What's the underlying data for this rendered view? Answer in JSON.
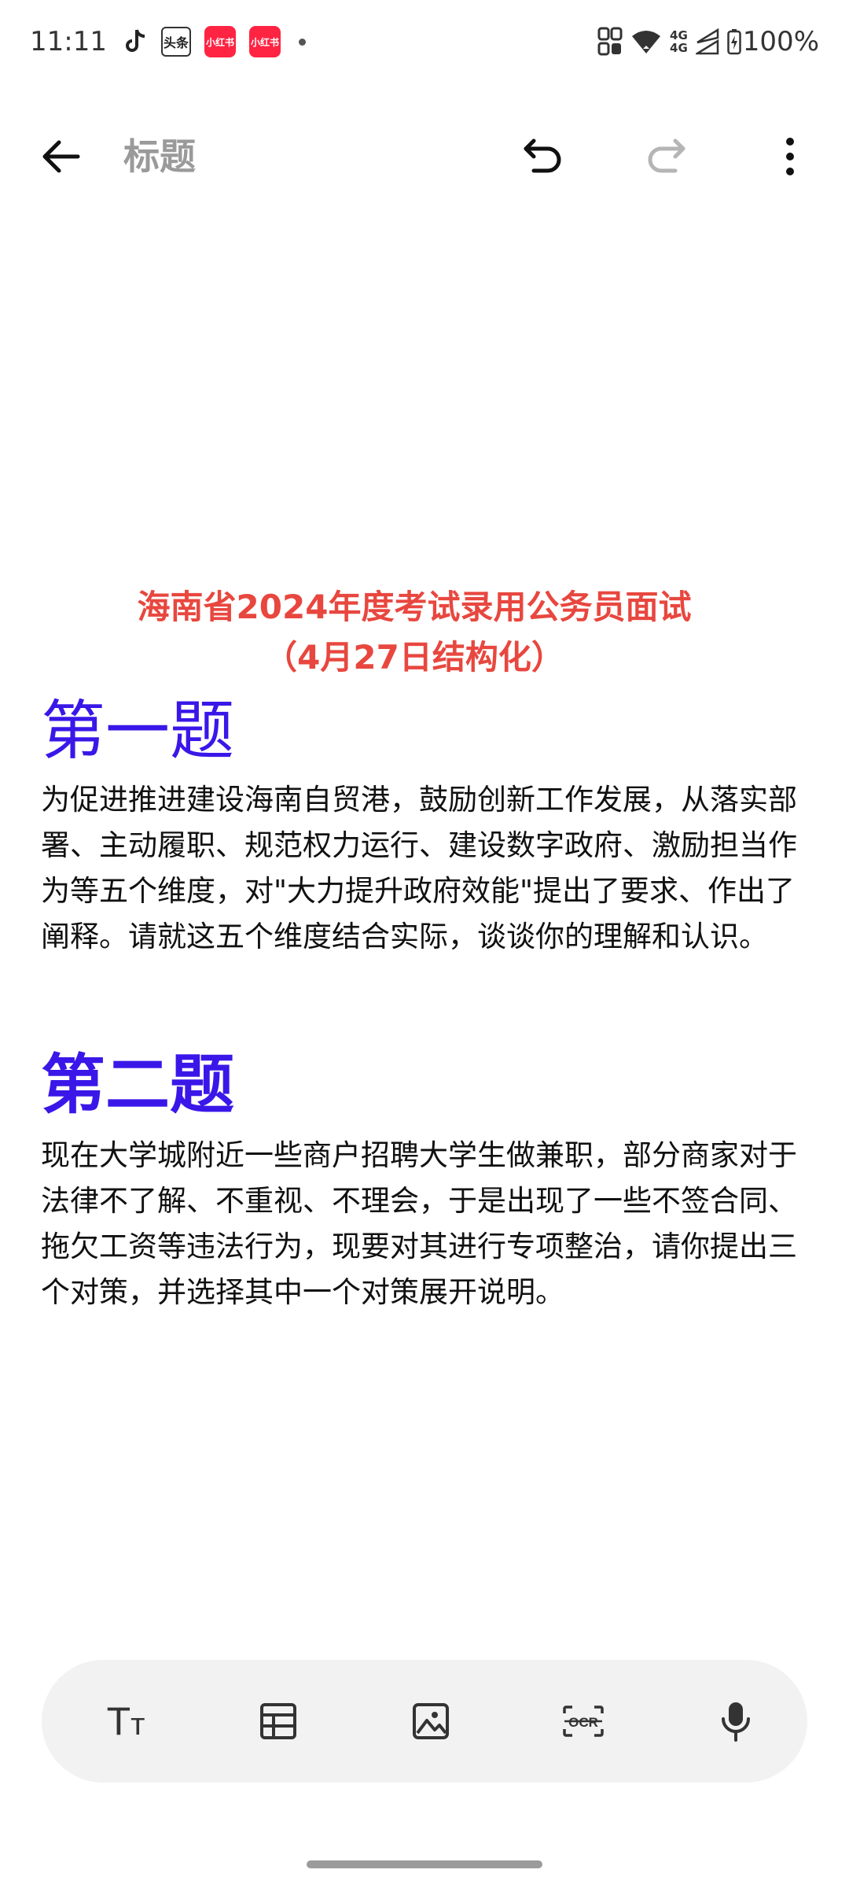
{
  "status_bar": {
    "time": "11:11",
    "notifications": [
      {
        "icon": "tiktok-icon"
      },
      {
        "icon": "toutiao-app-icon",
        "label": "头条"
      },
      {
        "icon": "xiaohongshu-app-icon",
        "label": "小红书"
      },
      {
        "icon": "xiaohongshu-app-icon",
        "label": "小红书"
      }
    ],
    "network_label_top": "4G",
    "network_label_bottom": "4G",
    "battery": "100%"
  },
  "app_bar": {
    "title_placeholder": "标题"
  },
  "document": {
    "title_line1": "海南省2024年度考试录用公务员面试",
    "title_line2": "（4月27日结构化）",
    "title_color": "#e8473f",
    "heading_color": "#3a17e8",
    "questions": [
      {
        "heading": "第一题",
        "body": "为促进推进建设海南自贸港，鼓励创新工作发展，从落实部署、主动履职、规范权力运行、建设数字政府、激励担当作为等五个维度，对\"大力提升政府效能\"提出了要求、作出了阐释。请就这五个维度结合实际，谈谈你的理解和认识。"
      },
      {
        "heading": "第二题",
        "body": "现在大学城附近一些商户招聘大学生做兼职，部分商家对于法律不了解、不重视、不理会，于是出现了一些不签合同、拖欠工资等违法行为，现要对其进行专项整治，请你提出三个对策，并选择其中一个对策展开说明。"
      }
    ]
  },
  "toolbar": {
    "items": [
      {
        "icon": "text-format-icon",
        "glyph": "Tт"
      },
      {
        "icon": "table-icon"
      },
      {
        "icon": "image-icon"
      },
      {
        "icon": "ocr-icon",
        "label": "OCR"
      },
      {
        "icon": "microphone-icon"
      }
    ]
  }
}
